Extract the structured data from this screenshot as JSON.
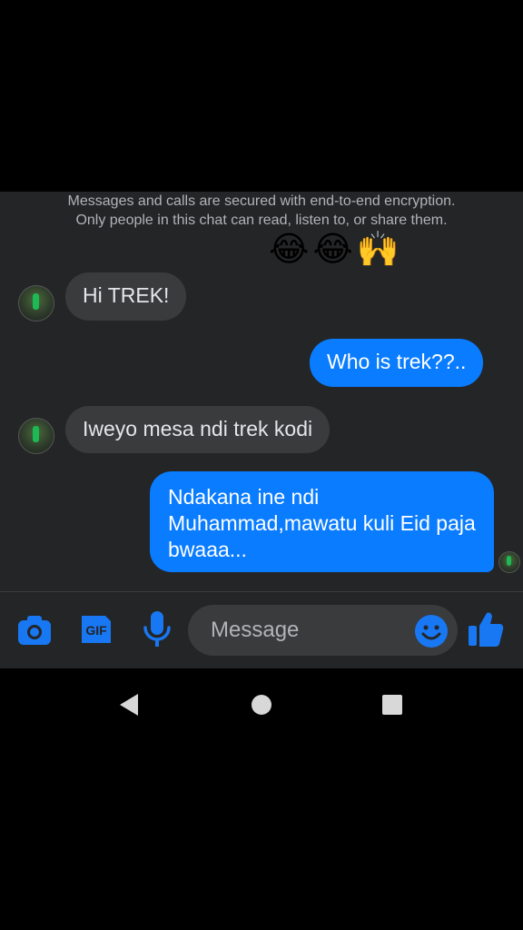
{
  "conversation": {
    "encryption_notice": "Messages and calls are secured with end-to-end encryption. Only people in this chat can read, listen to, or share them.",
    "emoji_reaction": [
      "😂",
      "😂",
      "🙌"
    ],
    "messages": [
      {
        "direction": "incoming",
        "text": "Hi TREK!"
      },
      {
        "direction": "outgoing",
        "text": "Who is trek??.."
      },
      {
        "direction": "incoming",
        "text": "Iweyo mesa ndi trek kodi"
      },
      {
        "direction": "outgoing",
        "text": "Ndakana ine ndi Muhammad,mawatu kuli Eid paja bwaaa..."
      }
    ]
  },
  "composer": {
    "placeholder": "Message",
    "icons": [
      "camera-icon",
      "gif-icon",
      "microphone-icon",
      "emoji-icon",
      "thumbs-up-icon"
    ]
  },
  "colors": {
    "background": "#242526",
    "incoming_bubble": "#3a3b3c",
    "outgoing_bubble": "#0a7cff",
    "accent": "#1877f2"
  },
  "navigation": [
    "back-icon",
    "home-icon",
    "recents-icon"
  ]
}
